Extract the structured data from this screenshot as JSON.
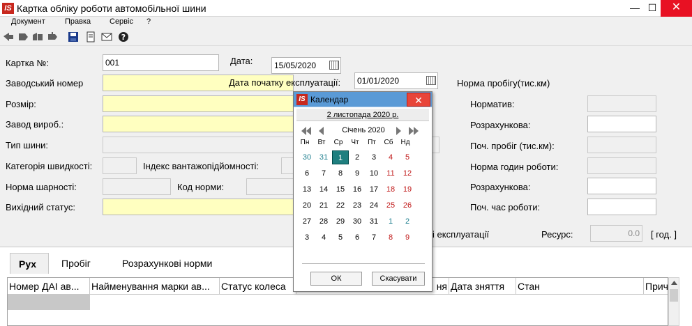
{
  "window": {
    "title": "Картка обліку роботи автомобільної шини",
    "logo": "IS",
    "min": "—",
    "max": "☐",
    "close": "✕"
  },
  "menu": [
    "Документ",
    "Правка",
    "Сервіс",
    "?"
  ],
  "toolbar": {
    "icons": [
      "back-icon",
      "forward-icon",
      "copy-icon",
      "paste-icon",
      "save-icon",
      "document-icon",
      "mail-icon",
      "help-icon"
    ]
  },
  "form": {
    "card_no_label": "Картка №:",
    "card_no_value": "001",
    "date_label": "Дата:",
    "date_value": "15/05/2020",
    "factory_no_label": "Заводський номер",
    "start_date_label": "Дата початку експлуатації:",
    "start_date_value": "01/01/2020",
    "mileage_norm_label": "Норма пробігу(тис.км)",
    "size_label": "Розмір:",
    "norm_label": "Норматив:",
    "manufacturer_label": "Завод вироб.:",
    "calc1_label": "Розрахункова:",
    "tire_type_label": "Тип шини:",
    "start_mileage_label": "Поч. пробіг (тис.км):",
    "speed_cat_label": "Категорія швидкості:",
    "load_index_label": "Індекс вантажопідйомності:",
    "work_hours_norm_label": "Норма годин роботи:",
    "wear_norm_label": "Норма шарності:",
    "norm_code_label": "Код норми:",
    "calc2_label": "Розрахункова:",
    "initial_status_label": "Вихідний статус:",
    "start_time_label": "Поч. час роботи:",
    "operation_partial": "і експлуатації",
    "resource_label": "Ресурс:",
    "resource_value": "0.0",
    "resource_unit": "[ год. ]"
  },
  "tabs": [
    "Рух",
    "Пробіг",
    "Розрахункові норми"
  ],
  "grid": {
    "columns": [
      "Номер ДАІ ав...",
      "Найменування марки ав...",
      "Статус колеса",
      "ня",
      "Дата зняття",
      "Стан",
      "Прич"
    ]
  },
  "calendar": {
    "title": "Календар",
    "logo": "IS",
    "close": "✕",
    "today_link": "2 листопада 2020 р.",
    "month": "Січень 2020",
    "weekdays": [
      "Пн",
      "Вт",
      "Ср",
      "Чт",
      "Пт",
      "Сб",
      "Нд"
    ],
    "weeks": [
      [
        "30",
        "31",
        "1",
        "2",
        "3",
        "4",
        "5"
      ],
      [
        "6",
        "7",
        "8",
        "9",
        "10",
        "11",
        "12"
      ],
      [
        "13",
        "14",
        "15",
        "16",
        "17",
        "18",
        "19"
      ],
      [
        "20",
        "21",
        "22",
        "23",
        "24",
        "25",
        "26"
      ],
      [
        "27",
        "28",
        "29",
        "30",
        "31",
        "1",
        "2"
      ],
      [
        "3",
        "4",
        "5",
        "6",
        "7",
        "8",
        "9"
      ]
    ],
    "ok": "ОК",
    "cancel": "Скасувати"
  }
}
